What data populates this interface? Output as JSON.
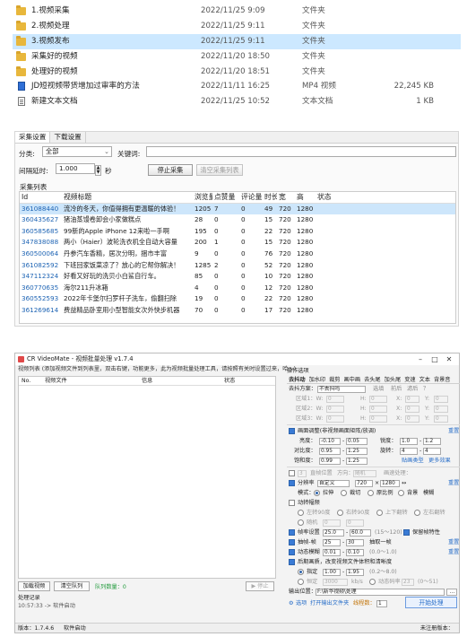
{
  "files": [
    {
      "name": "1.视频采集",
      "date": "2022/11/25 9:09",
      "type": "文件夹",
      "size": "",
      "icon": "folder-icon"
    },
    {
      "name": "2.视频处理",
      "date": "2022/11/25 9:11",
      "type": "文件夹",
      "size": "",
      "icon": "folder-icon"
    },
    {
      "name": "3.视频发布",
      "date": "2022/11/25 9:11",
      "type": "文件夹",
      "size": "",
      "icon": "folder-icon",
      "selected": true
    },
    {
      "name": "采集好的视频",
      "date": "2022/11/20 18:50",
      "type": "文件夹",
      "size": "",
      "icon": "folder-icon"
    },
    {
      "name": "处理好的视频",
      "date": "2022/11/20 18:51",
      "type": "文件夹",
      "size": "",
      "icon": "folder-icon"
    },
    {
      "name": "JD短视频带货增加过审率的方法",
      "date": "2022/11/11 16:25",
      "type": "MP4 视频",
      "size": "22,245 KB",
      "icon": "video-file-icon"
    },
    {
      "name": "新建文本文档",
      "date": "2022/11/25 10:52",
      "type": "文本文档",
      "size": "1 KB",
      "icon": "text-file-icon"
    }
  ],
  "collector": {
    "tabs": [
      "采集设置",
      "下载设置"
    ],
    "category_label": "分类:",
    "category_value": "全部",
    "keyword_label": "关键词:",
    "keyword_value": "",
    "interval_label": "间隔延时:",
    "interval_value": "1.000",
    "interval_unit": "秒",
    "stop_button": "停止采集",
    "clear_button": "清空采集列表",
    "list_title": "采集列表",
    "columns": [
      "Id",
      "视频标题",
      "浏览量",
      "点赞量",
      "评论量",
      "时长",
      "宽",
      "高",
      "状态"
    ],
    "rows": [
      {
        "id": "361088440",
        "title": "流冷的冬天，你值得拥有更温暖的体验！",
        "views": "1205",
        "likes": "7",
        "comments": "0",
        "duration": "49",
        "width": "720",
        "height": "1280",
        "status": "",
        "selected": true
      },
      {
        "id": "360435627",
        "title": "猪油蒸馒卷卸会小家做糕点",
        "views": "28",
        "likes": "0",
        "comments": "0",
        "duration": "15",
        "width": "720",
        "height": "1280",
        "status": ""
      },
      {
        "id": "360585685",
        "title": "99新的Apple iPhone 12来啦一手啊",
        "views": "195",
        "likes": "0",
        "comments": "0",
        "duration": "22",
        "width": "720",
        "height": "1280",
        "status": ""
      },
      {
        "id": "347838088",
        "title": "两小（Haier）波轮洗衣机全自动大容量",
        "views": "200",
        "likes": "1",
        "comments": "0",
        "duration": "15",
        "width": "720",
        "height": "1280",
        "status": ""
      },
      {
        "id": "360500064",
        "title": "丹参汽车香精，居次分明，捆市丰富",
        "views": "9",
        "likes": "0",
        "comments": "0",
        "duration": "76",
        "width": "720",
        "height": "1280",
        "status": ""
      },
      {
        "id": "361082592",
        "title": "下班回家饭菜凉了？放心的它帮你解决！",
        "views": "1285",
        "likes": "2",
        "comments": "0",
        "duration": "52",
        "width": "720",
        "height": "1280",
        "status": ""
      },
      {
        "id": "347112324",
        "title": "好看又好玩的洗贝小白鲨自行车。",
        "views": "85",
        "likes": "0",
        "comments": "0",
        "duration": "10",
        "width": "720",
        "height": "1280",
        "status": ""
      },
      {
        "id": "360770635",
        "title": "海尔211升冰箱",
        "views": "4",
        "likes": "0",
        "comments": "0",
        "duration": "12",
        "width": "720",
        "height": "1280",
        "status": ""
      },
      {
        "id": "360552593",
        "title": "2022年卡堡尔扫罗杆子洗车，偷翻扫除",
        "views": "19",
        "likes": "0",
        "comments": "0",
        "duration": "22",
        "width": "720",
        "height": "1280",
        "status": ""
      },
      {
        "id": "361269614",
        "title": "费益精品卧室用小型智能女次外快步机器",
        "views": "70",
        "likes": "0",
        "comments": "0",
        "duration": "17",
        "width": "720",
        "height": "1280",
        "status": ""
      }
    ]
  },
  "videomate": {
    "title": "CR VideoMate - 视频批量处理 v1.7.4",
    "hint": "视频列表 (添加视频文件到列表里，双击右键，功能更多，此为视频批量处理工具，请按照有关时设置过来，哈～)",
    "list_columns": [
      "No.",
      "视频文件",
      "信息",
      "状态"
    ],
    "add_button": "加载视频",
    "clear_button": "清空队列",
    "queue_count": "队列数量：0",
    "stop_button": "▶ 停止",
    "log_title": "处理记录",
    "log_line": "10:57:33 -> 软件启动",
    "status_version": "版本：1.7.4.6",
    "status_state": "软件启动",
    "status_right": "未注册版本：",
    "ops_title": "操作选项",
    "ops_tabs": [
      "去抖动",
      "加水印",
      "裁剪",
      "画中画",
      "去头尾",
      "加头尾",
      "变速",
      "文本",
      "背景音"
    ],
    "crop_mode_label": "去抖方案：",
    "crop_mode_value": "不去抖吗",
    "crop_opts": [
      "选填",
      "前后",
      "滤后",
      "？"
    ],
    "region1": "区域1：W:",
    "region2": "区域2：W:",
    "region3": "区域3：W:",
    "zero": "0",
    "h_label": "H:",
    "x_label": "X:",
    "y_label": "Y:",
    "color_adj": "画面调整(非视频画面矩阵/放调)",
    "brightness": "亮度：",
    "contrast": "对比度：",
    "saturation": "饱和度：",
    "sharpen": "锐度：",
    "rotate": "旋转：",
    "b_min": "-0.10",
    "b_max": "0.05",
    "c_min": "0.95",
    "c_max": "1.25",
    "s_min": "0.99",
    "s_max": "1.25",
    "sharp_min": "1.0",
    "sharp_max": "1.2",
    "rot_min": "4",
    "rot_max": "4",
    "reset_link": "重置",
    "random_link": "贴画类型",
    "more_link": "更多效果",
    "frame_label": "直帧位置",
    "frame_value": "3",
    "mirror_label": "方向：",
    "mirror_value": "随机",
    "speed_label": "画速处理：",
    "resolution_label": "分辨率",
    "res_mode": "自定义",
    "res_w": "720",
    "res_h": "1280",
    "mode_label": "模式：",
    "mode_opts": [
      "拉伸",
      "裁切",
      "原比例",
      "背景",
      "模糊"
    ],
    "shift_label": "动转幅频",
    "shift_opts": [
      "左转90度",
      "右转90度",
      "上下翻转",
      "左右翻转"
    ],
    "random_label": "随机",
    "fps_label": "帧率设置",
    "fps_min": "25.0",
    "fps_max": "60.0",
    "fps_range": "(15～120)",
    "fps_keep": "保留帧特性",
    "bitrate_label": "抽帧-帧",
    "bitrate_min": "25",
    "bitrate_max": "30",
    "bitrate_note": "抽取一帧",
    "dyn_label": "动态模糊",
    "dyn_min": "0.01",
    "dyn_max": "0.10",
    "dyn_range": "(0.0～1.0)",
    "pp_label": "后期画质，改变视频文件体积和清晰度",
    "pp_opt1": "指定",
    "pp_min": "1.00",
    "pp_max": "1.95",
    "pp_range": "(0.2～8.0)",
    "pp_opt2": "恒定",
    "pp_bitrate": "3000",
    "pp_unit": "kb/s",
    "pp_dyn": "动态码率",
    "pp_dyn_val": "23",
    "pp_dyn_range": "(0～51)",
    "output_label": "输出位置：",
    "output_path": "F:\\新华视频\\处理",
    "link_settings": "选项",
    "link_open": "打开输出文件夹",
    "threads_label": "线程数：",
    "threads_value": "1",
    "start_button": "开始处理"
  }
}
